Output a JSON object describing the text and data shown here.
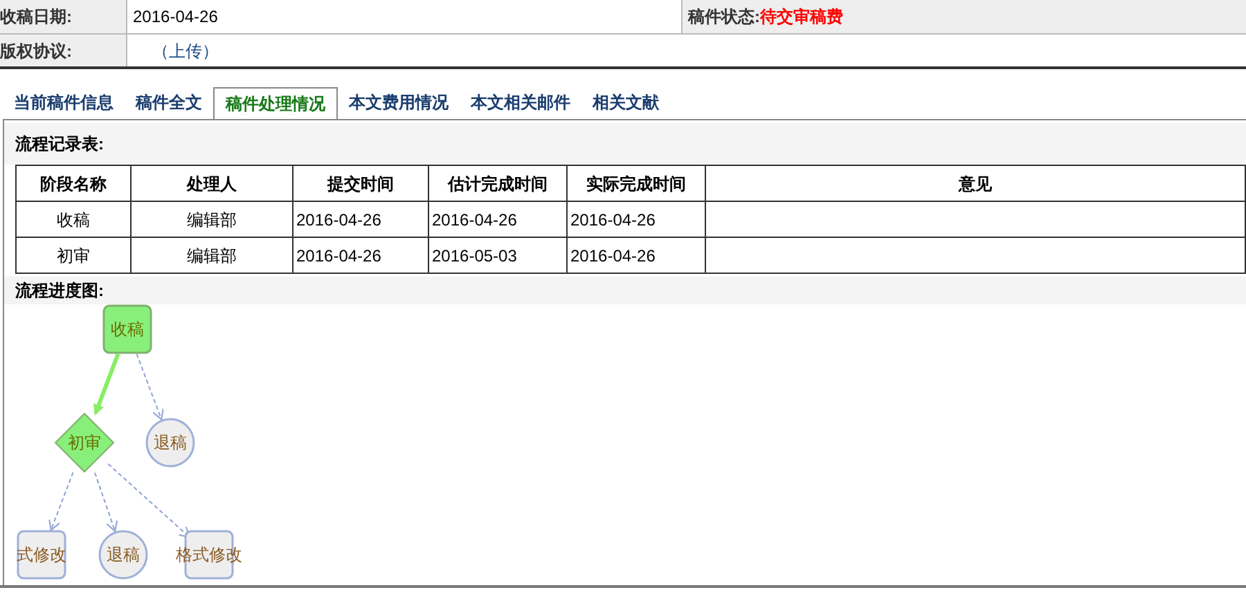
{
  "header": {
    "received_date": {
      "label": "收稿日期:",
      "value": "2016-04-26"
    },
    "status": {
      "label": "稿件状态:",
      "value": "待交审稿费"
    },
    "copyright": {
      "label": "版权协议:",
      "link": "（上传）"
    }
  },
  "tabs": [
    {
      "label": "当前稿件信息",
      "selected": false
    },
    {
      "label": "稿件全文",
      "selected": false
    },
    {
      "label": "稿件处理情况",
      "selected": true
    },
    {
      "label": "本文费用情况",
      "selected": false
    },
    {
      "label": "本文相关邮件",
      "selected": false
    },
    {
      "label": "相关文献",
      "selected": false
    }
  ],
  "record_table": {
    "title": "流程记录表:",
    "columns": [
      "阶段名称",
      "处理人",
      "提交时间",
      "估计完成时间",
      "实际完成时间",
      "意见"
    ],
    "rows": [
      [
        "收稿",
        "编辑部",
        "2016-04-26",
        "2016-04-26",
        "2016-04-26",
        ""
      ],
      [
        "初审",
        "编辑部",
        "2016-04-26",
        "2016-05-03",
        "2016-04-26",
        ""
      ]
    ]
  },
  "flow_chart": {
    "title": "流程进度图:",
    "nodes": [
      {
        "label": "收稿",
        "kind": "rect",
        "done": true
      },
      {
        "label": "初审",
        "kind": "diamond",
        "done": true
      },
      {
        "label": "退稿",
        "kind": "circle",
        "done": false
      },
      {
        "label": "式修改",
        "kind": "rect",
        "done": false
      },
      {
        "label": "退稿",
        "kind": "circle",
        "done": false
      },
      {
        "label": "格式修改",
        "kind": "rect",
        "done": false
      }
    ],
    "edges": [
      {
        "active": true
      },
      {
        "active": false
      },
      {
        "active": false
      },
      {
        "active": false
      },
      {
        "active": false
      }
    ]
  }
}
